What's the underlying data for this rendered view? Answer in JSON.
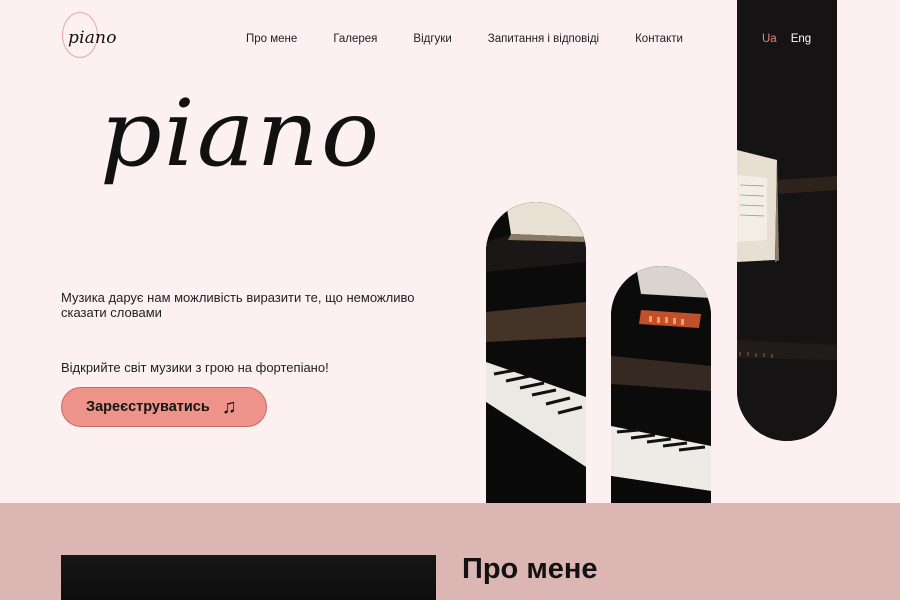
{
  "header": {
    "logo_text": "piano",
    "nav": [
      {
        "label": "Про мене"
      },
      {
        "label": "Галерея"
      },
      {
        "label": "Відгуки"
      },
      {
        "label": "Запитання і відповіді"
      },
      {
        "label": "Контакти"
      }
    ],
    "languages": [
      {
        "label": "Ua",
        "active": true
      },
      {
        "label": "Eng",
        "active": false
      }
    ]
  },
  "hero": {
    "title": "piano",
    "tagline": "Музика дарує нам можливість виразити те, що неможливо сказати словами",
    "discover": "Відкрийте світ музики з грою на фортепіано!",
    "cta_label": "Зареєструватись",
    "cta_icon": "music-note-icon",
    "cta_icon_glyph": "♫"
  },
  "about": {
    "title": "Про мене"
  },
  "colors": {
    "background": "#fcf0f0",
    "accent": "#ee938a",
    "section_band": "#dcb6b3",
    "active_lang": "#e8837a"
  }
}
